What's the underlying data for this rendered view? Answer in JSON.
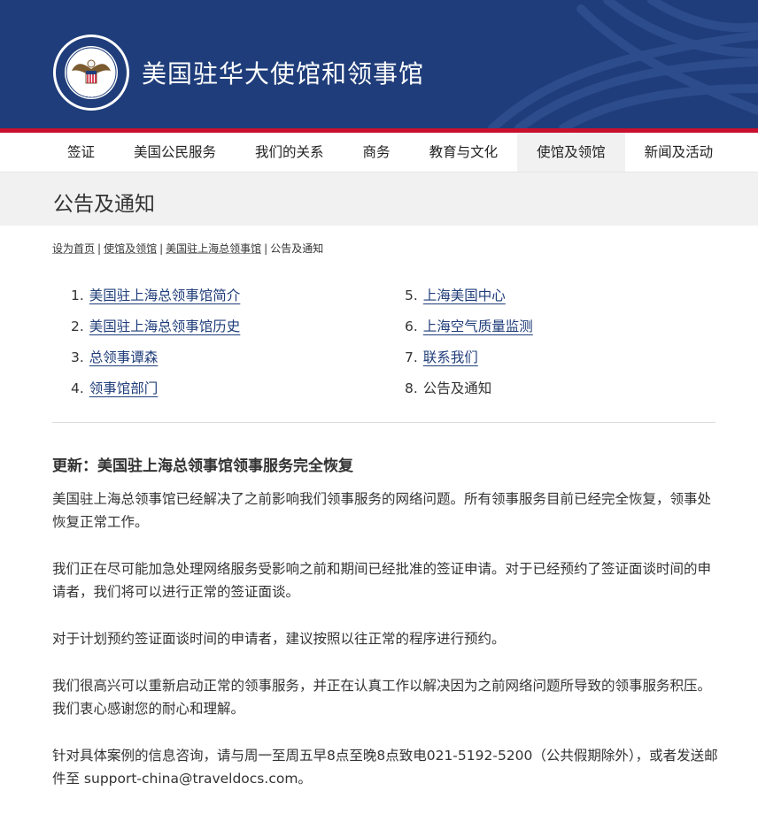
{
  "header": {
    "site_title": "美国驻华大使馆和领事馆",
    "colors": {
      "navy": "#1f3d7a",
      "red": "#c8102e"
    }
  },
  "nav": {
    "items": [
      "签证",
      "美国公民服务",
      "我们的关系",
      "商务",
      "教育与文化",
      "使馆及领馆",
      "新闻及活动"
    ],
    "active": "使馆及领馆"
  },
  "page": {
    "title": "公告及通知"
  },
  "breadcrumb": {
    "items": [
      "设为首页",
      "使馆及领馆",
      "美国驻上海总领事馆",
      "公告及通知"
    ],
    "separator": "|"
  },
  "toc": {
    "left": [
      {
        "num": "1.",
        "label": "美国驻上海总领事馆简介"
      },
      {
        "num": "2.",
        "label": "美国驻上海总领事馆历史"
      },
      {
        "num": "3.",
        "label": "总领事谭森"
      },
      {
        "num": "4.",
        "label": "领事馆部门"
      }
    ],
    "right": [
      {
        "num": "5.",
        "label": "上海美国中心"
      },
      {
        "num": "6.",
        "label": "上海空气质量监测"
      },
      {
        "num": "7.",
        "label": "联系我们"
      },
      {
        "num": "8.",
        "label": "公告及通知"
      }
    ]
  },
  "article": {
    "heading": "更新：美国驻上海总领事馆领事服务完全恢复",
    "paragraphs": [
      "美国驻上海总领事馆已经解决了之前影响我们领事服务的网络问题。所有领事服务目前已经完全恢复，领事处恢复正常工作。",
      "我们正在尽可能加急处理网络服务受影响之前和期间已经批准的签证申请。对于已经预约了签证面谈时间的申请者，我们将可以进行正常的签证面谈。",
      "对于计划预约签证面谈时间的申请者，建议按照以往正常的程序进行预约。",
      "我们很高兴可以重新启动正常的领事服务，并正在认真工作以解决因为之前网络问题所导致的领事服务积压。我们衷心感谢您的耐心和理解。",
      "针对具体案例的信息咨询，请与周一至周五早8点至晚8点致电021-5192-5200（公共假期除外），或者发送邮件至 support-china@traveldocs.com。"
    ]
  }
}
